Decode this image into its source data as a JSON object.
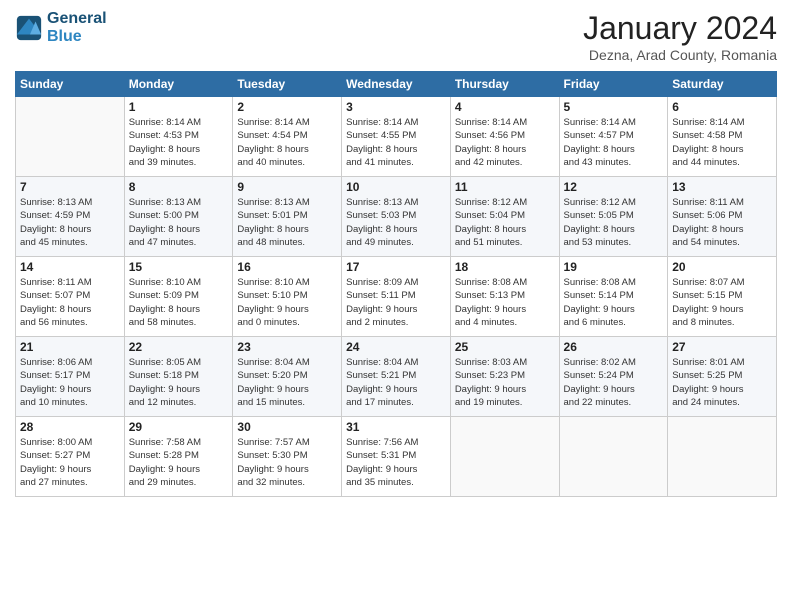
{
  "header": {
    "logo_line1": "General",
    "logo_line2": "Blue",
    "month_title": "January 2024",
    "subtitle": "Dezna, Arad County, Romania"
  },
  "weekdays": [
    "Sunday",
    "Monday",
    "Tuesday",
    "Wednesday",
    "Thursday",
    "Friday",
    "Saturday"
  ],
  "weeks": [
    [
      {
        "day": "",
        "info": ""
      },
      {
        "day": "1",
        "info": "Sunrise: 8:14 AM\nSunset: 4:53 PM\nDaylight: 8 hours\nand 39 minutes."
      },
      {
        "day": "2",
        "info": "Sunrise: 8:14 AM\nSunset: 4:54 PM\nDaylight: 8 hours\nand 40 minutes."
      },
      {
        "day": "3",
        "info": "Sunrise: 8:14 AM\nSunset: 4:55 PM\nDaylight: 8 hours\nand 41 minutes."
      },
      {
        "day": "4",
        "info": "Sunrise: 8:14 AM\nSunset: 4:56 PM\nDaylight: 8 hours\nand 42 minutes."
      },
      {
        "day": "5",
        "info": "Sunrise: 8:14 AM\nSunset: 4:57 PM\nDaylight: 8 hours\nand 43 minutes."
      },
      {
        "day": "6",
        "info": "Sunrise: 8:14 AM\nSunset: 4:58 PM\nDaylight: 8 hours\nand 44 minutes."
      }
    ],
    [
      {
        "day": "7",
        "info": "Sunrise: 8:13 AM\nSunset: 4:59 PM\nDaylight: 8 hours\nand 45 minutes."
      },
      {
        "day": "8",
        "info": "Sunrise: 8:13 AM\nSunset: 5:00 PM\nDaylight: 8 hours\nand 47 minutes."
      },
      {
        "day": "9",
        "info": "Sunrise: 8:13 AM\nSunset: 5:01 PM\nDaylight: 8 hours\nand 48 minutes."
      },
      {
        "day": "10",
        "info": "Sunrise: 8:13 AM\nSunset: 5:03 PM\nDaylight: 8 hours\nand 49 minutes."
      },
      {
        "day": "11",
        "info": "Sunrise: 8:12 AM\nSunset: 5:04 PM\nDaylight: 8 hours\nand 51 minutes."
      },
      {
        "day": "12",
        "info": "Sunrise: 8:12 AM\nSunset: 5:05 PM\nDaylight: 8 hours\nand 53 minutes."
      },
      {
        "day": "13",
        "info": "Sunrise: 8:11 AM\nSunset: 5:06 PM\nDaylight: 8 hours\nand 54 minutes."
      }
    ],
    [
      {
        "day": "14",
        "info": "Sunrise: 8:11 AM\nSunset: 5:07 PM\nDaylight: 8 hours\nand 56 minutes."
      },
      {
        "day": "15",
        "info": "Sunrise: 8:10 AM\nSunset: 5:09 PM\nDaylight: 8 hours\nand 58 minutes."
      },
      {
        "day": "16",
        "info": "Sunrise: 8:10 AM\nSunset: 5:10 PM\nDaylight: 9 hours\nand 0 minutes."
      },
      {
        "day": "17",
        "info": "Sunrise: 8:09 AM\nSunset: 5:11 PM\nDaylight: 9 hours\nand 2 minutes."
      },
      {
        "day": "18",
        "info": "Sunrise: 8:08 AM\nSunset: 5:13 PM\nDaylight: 9 hours\nand 4 minutes."
      },
      {
        "day": "19",
        "info": "Sunrise: 8:08 AM\nSunset: 5:14 PM\nDaylight: 9 hours\nand 6 minutes."
      },
      {
        "day": "20",
        "info": "Sunrise: 8:07 AM\nSunset: 5:15 PM\nDaylight: 9 hours\nand 8 minutes."
      }
    ],
    [
      {
        "day": "21",
        "info": "Sunrise: 8:06 AM\nSunset: 5:17 PM\nDaylight: 9 hours\nand 10 minutes."
      },
      {
        "day": "22",
        "info": "Sunrise: 8:05 AM\nSunset: 5:18 PM\nDaylight: 9 hours\nand 12 minutes."
      },
      {
        "day": "23",
        "info": "Sunrise: 8:04 AM\nSunset: 5:20 PM\nDaylight: 9 hours\nand 15 minutes."
      },
      {
        "day": "24",
        "info": "Sunrise: 8:04 AM\nSunset: 5:21 PM\nDaylight: 9 hours\nand 17 minutes."
      },
      {
        "day": "25",
        "info": "Sunrise: 8:03 AM\nSunset: 5:23 PM\nDaylight: 9 hours\nand 19 minutes."
      },
      {
        "day": "26",
        "info": "Sunrise: 8:02 AM\nSunset: 5:24 PM\nDaylight: 9 hours\nand 22 minutes."
      },
      {
        "day": "27",
        "info": "Sunrise: 8:01 AM\nSunset: 5:25 PM\nDaylight: 9 hours\nand 24 minutes."
      }
    ],
    [
      {
        "day": "28",
        "info": "Sunrise: 8:00 AM\nSunset: 5:27 PM\nDaylight: 9 hours\nand 27 minutes."
      },
      {
        "day": "29",
        "info": "Sunrise: 7:58 AM\nSunset: 5:28 PM\nDaylight: 9 hours\nand 29 minutes."
      },
      {
        "day": "30",
        "info": "Sunrise: 7:57 AM\nSunset: 5:30 PM\nDaylight: 9 hours\nand 32 minutes."
      },
      {
        "day": "31",
        "info": "Sunrise: 7:56 AM\nSunset: 5:31 PM\nDaylight: 9 hours\nand 35 minutes."
      },
      {
        "day": "",
        "info": ""
      },
      {
        "day": "",
        "info": ""
      },
      {
        "day": "",
        "info": ""
      }
    ]
  ]
}
